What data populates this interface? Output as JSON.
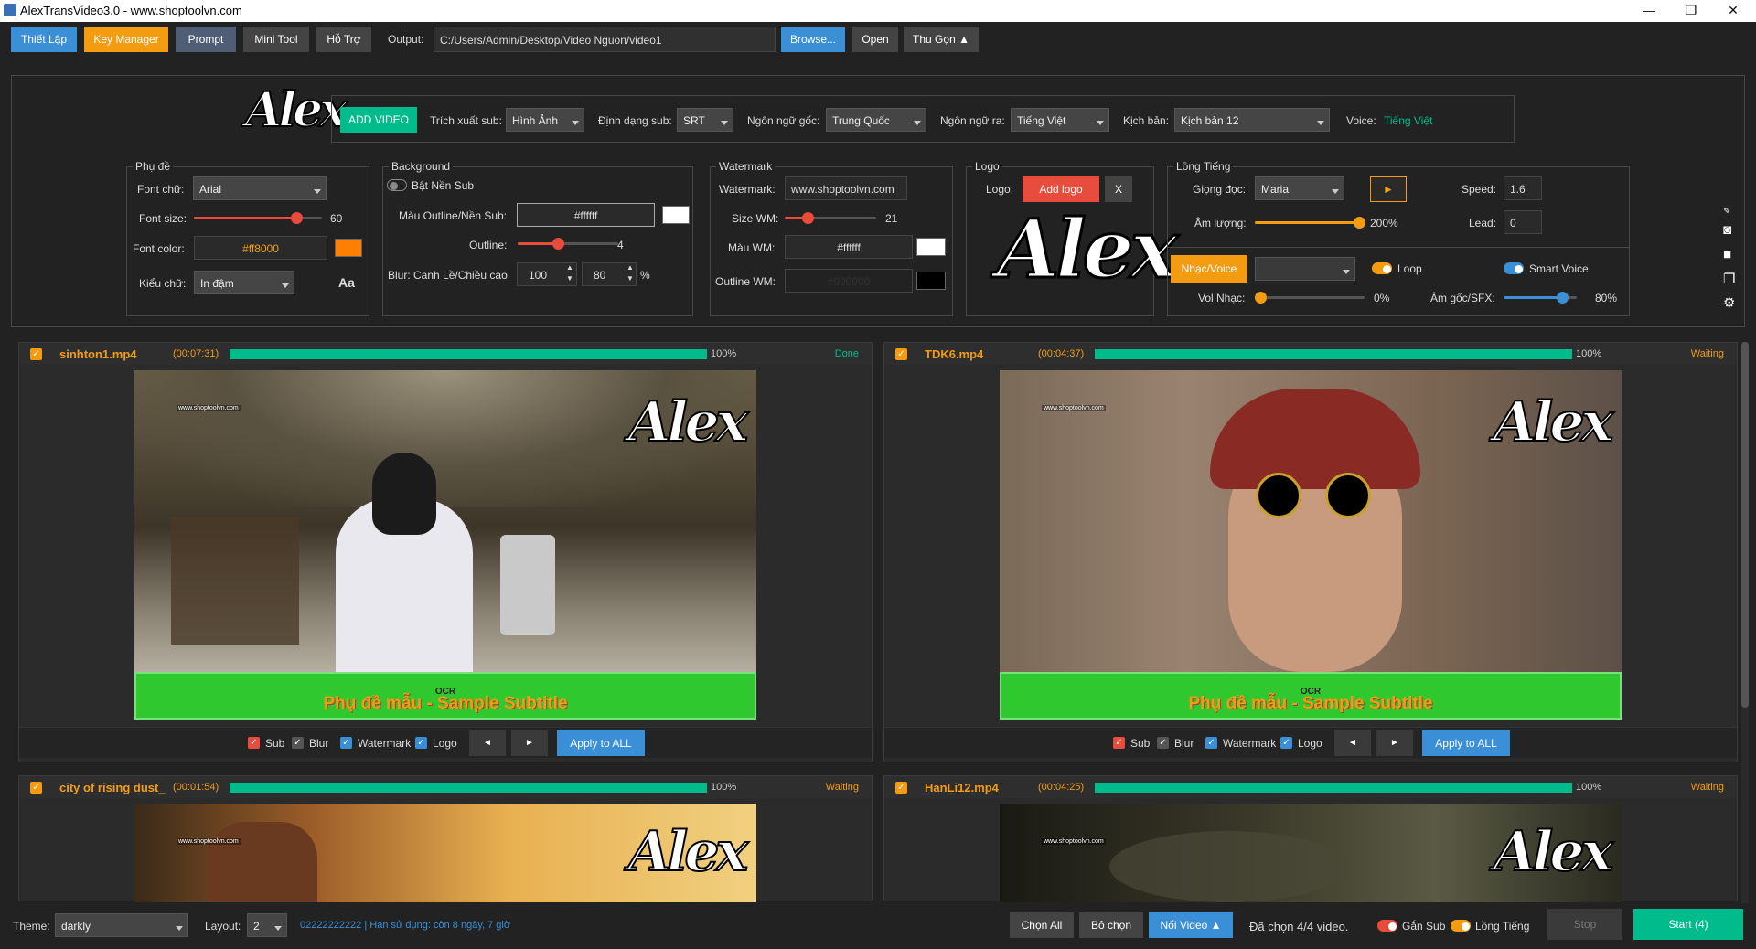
{
  "window": {
    "title": "AlexTransVideo3.0 - www.shoptoolvn.com",
    "minimize": "—",
    "maximize": "❐",
    "close": "✕"
  },
  "toolbar": {
    "thiet_lap": "Thiết Lập",
    "key_manager": "Key Manager",
    "prompt": "Prompt",
    "mini_tool": "Mini Tool",
    "ho_tro": "Hỗ Trợ",
    "output_label": "Output:",
    "output_path": "C:/Users/Admin/Desktop/Video Nguon/video1",
    "browse": "Browse...",
    "open": "Open",
    "thu_gon": "Thu Gọn ▲"
  },
  "logo_text": "Alex",
  "top_row": {
    "add_video": "ADD VIDEO",
    "trich_xuat_label": "Trích xuất sub:",
    "trich_xuat_value": "Hình Ảnh",
    "dinh_dang_label": "Định dạng sub:",
    "dinh_dang_value": "SRT",
    "ngon_ngu_goc_label": "Ngôn ngữ gốc:",
    "ngon_ngu_goc_value": "Trung Quốc",
    "ngon_ngu_ra_label": "Ngôn ngữ ra:",
    "ngon_ngu_ra_value": "Tiếng Việt",
    "kich_ban_label": "Kịch bản:",
    "kich_ban_value": "Kịch bản 12",
    "voice_label": "Voice:",
    "voice_value": "Tiếng Việt"
  },
  "phu_de": {
    "title": "Phụ đề",
    "font_chu_label": "Font chữ:",
    "font_chu_value": "Arial",
    "font_size_label": "Font size:",
    "font_size_value": "60",
    "font_size_level": 0.8,
    "font_color_label": "Font color:",
    "font_color_value": "#ff8000",
    "kieu_chu_label": "Kiểu chữ:",
    "kieu_chu_value": "In đậm",
    "aa": "Aa"
  },
  "background": {
    "title": "Background",
    "bat_nen_sub": "Bật Nền Sub",
    "mau_label": "Màu Outline/Nền Sub:",
    "mau_value": "#ffffff",
    "outline_label": "Outline:",
    "outline_value": "4",
    "outline_level": 0.4,
    "blur_label": "Blur: Canh Lề/Chiều cao:",
    "blur_value1": "100",
    "blur_value2": "80",
    "percent": "%"
  },
  "watermark": {
    "title": "Watermark",
    "wm_label": "Watermark:",
    "wm_value": "www.shoptoolvn.com",
    "size_label": "Size WM:",
    "size_value": "21",
    "size_level": 0.25,
    "mau_label": "Màu WM:",
    "mau_value": "#ffffff",
    "outline_label": "Outline WM:",
    "outline_value": "#000000"
  },
  "logo": {
    "title": "Logo",
    "label": "Logo:",
    "add": "Add logo",
    "x": "X"
  },
  "long_tieng": {
    "title": "Lồng Tiếng",
    "giong_doc_label": "Giọng đọc:",
    "giong_doc_value": "Maria",
    "play": "►",
    "speed_label": "Speed:",
    "speed_value": "1.6",
    "am_luong_label": "Âm lượng:",
    "am_luong_value": "200%",
    "am_luong_level": 1.0,
    "lead_label": "Lead:",
    "lead_value": "0",
    "nhac_voice": "Nhạc/Voice",
    "nhac_select": "",
    "loop": "Loop",
    "smart_voice": "Smart Voice",
    "vol_nhac_label": "Vol Nhạc:",
    "vol_nhac_value": "0%",
    "vol_nhac_level": 0.0,
    "am_goc_label": "Âm gốc/SFX:",
    "am_goc_value": "80%",
    "am_goc_level": 0.8
  },
  "videos": [
    {
      "name": "sinhton1.mp4",
      "duration": "(00:07:31)",
      "progress": 1.0,
      "percent": "100%",
      "status": "Done",
      "status_color": "#00bc8c",
      "subtitle": "Phụ đề mẫu - Sample Subtitle",
      "ocr": "OCR",
      "watermark": "www.shoptoolvn.com"
    },
    {
      "name": "TDK6.mp4",
      "duration": "(00:04:37)",
      "progress": 1.0,
      "percent": "100%",
      "status": "Waiting",
      "status_color": "#f39c12",
      "subtitle": "Phụ đề mẫu - Sample Subtitle",
      "ocr": "OCR",
      "watermark": "www.shoptoolvn.com"
    },
    {
      "name": "city of rising dust_",
      "duration": "(00:01:54)",
      "progress": 1.0,
      "percent": "100%",
      "status": "Waiting",
      "status_color": "#f39c12",
      "watermark": "www.shoptoolvn.com"
    },
    {
      "name": "HanLi12.mp4",
      "duration": "(00:04:25)",
      "progress": 1.0,
      "percent": "100%",
      "status": "Waiting",
      "status_color": "#f39c12",
      "watermark": "www.shoptoolvn.com"
    }
  ],
  "card_controls": {
    "sub": "Sub",
    "blur": "Blur",
    "watermark": "Watermark",
    "logo": "Logo",
    "prev": "◄",
    "next": "►",
    "apply": "Apply to ALL"
  },
  "footer": {
    "theme_label": "Theme:",
    "theme_value": "darkly",
    "layout_label": "Layout:",
    "layout_value": "2",
    "license": "02222222222 | Hạn sử dụng: còn 8 ngày, 7 giờ",
    "chon_all": "Chọn All",
    "bo_chon": "Bỏ chọn",
    "noi_video": "Nối Video ▲",
    "da_chon": "Đã chọn 4/4 video.",
    "gan_sub": "Gắn Sub",
    "long_tieng": "Lồng Tiếng",
    "stop": "Stop",
    "start": "Start (4)"
  },
  "colors": {
    "accent_blue": "#3b8fd6",
    "accent_orange": "#f39c12",
    "accent_green": "#00bc8c",
    "danger": "#e74c3c"
  }
}
